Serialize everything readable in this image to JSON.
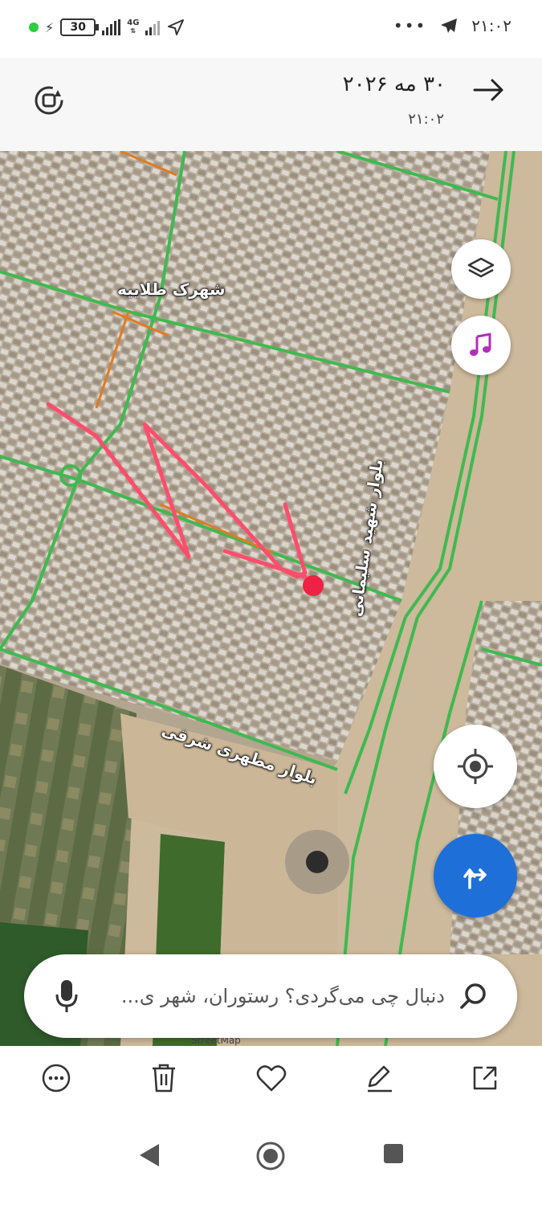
{
  "status_bar": {
    "battery": "30",
    "network": "4G",
    "time": "۲۱:۰۲"
  },
  "header": {
    "date": "۳۰ مه ۲۰۲۶",
    "time": "۲۱:۰۲"
  },
  "map": {
    "labels": {
      "talayie": "شهرک طلاییه",
      "motahari": "بلوار مطهری شرقی",
      "soleimani": "بلوار شهید سلیمانی"
    },
    "attribution": "StreetMap"
  },
  "search": {
    "placeholder": "دنبال چی می‌گردی؟ رستوران، شهر ی..."
  },
  "colors": {
    "accent": "#1f6fd8",
    "marker": "#ee2244",
    "scribble": "#ff4d6d",
    "road_green": "#3fb950",
    "road_orange": "#e07b22",
    "music": "#b02fb5"
  },
  "icons": {
    "refresh": "refresh-icon",
    "back": "arrow-right-icon",
    "layers": "layers-icon",
    "music": "music-note-icon",
    "locate": "crosshair-icon",
    "route": "directions-icon",
    "search": "search-icon",
    "mic": "microphone-icon",
    "more": "more-icon",
    "delete": "trash-icon",
    "favorite": "heart-icon",
    "edit": "pencil-icon",
    "share": "share-icon"
  }
}
